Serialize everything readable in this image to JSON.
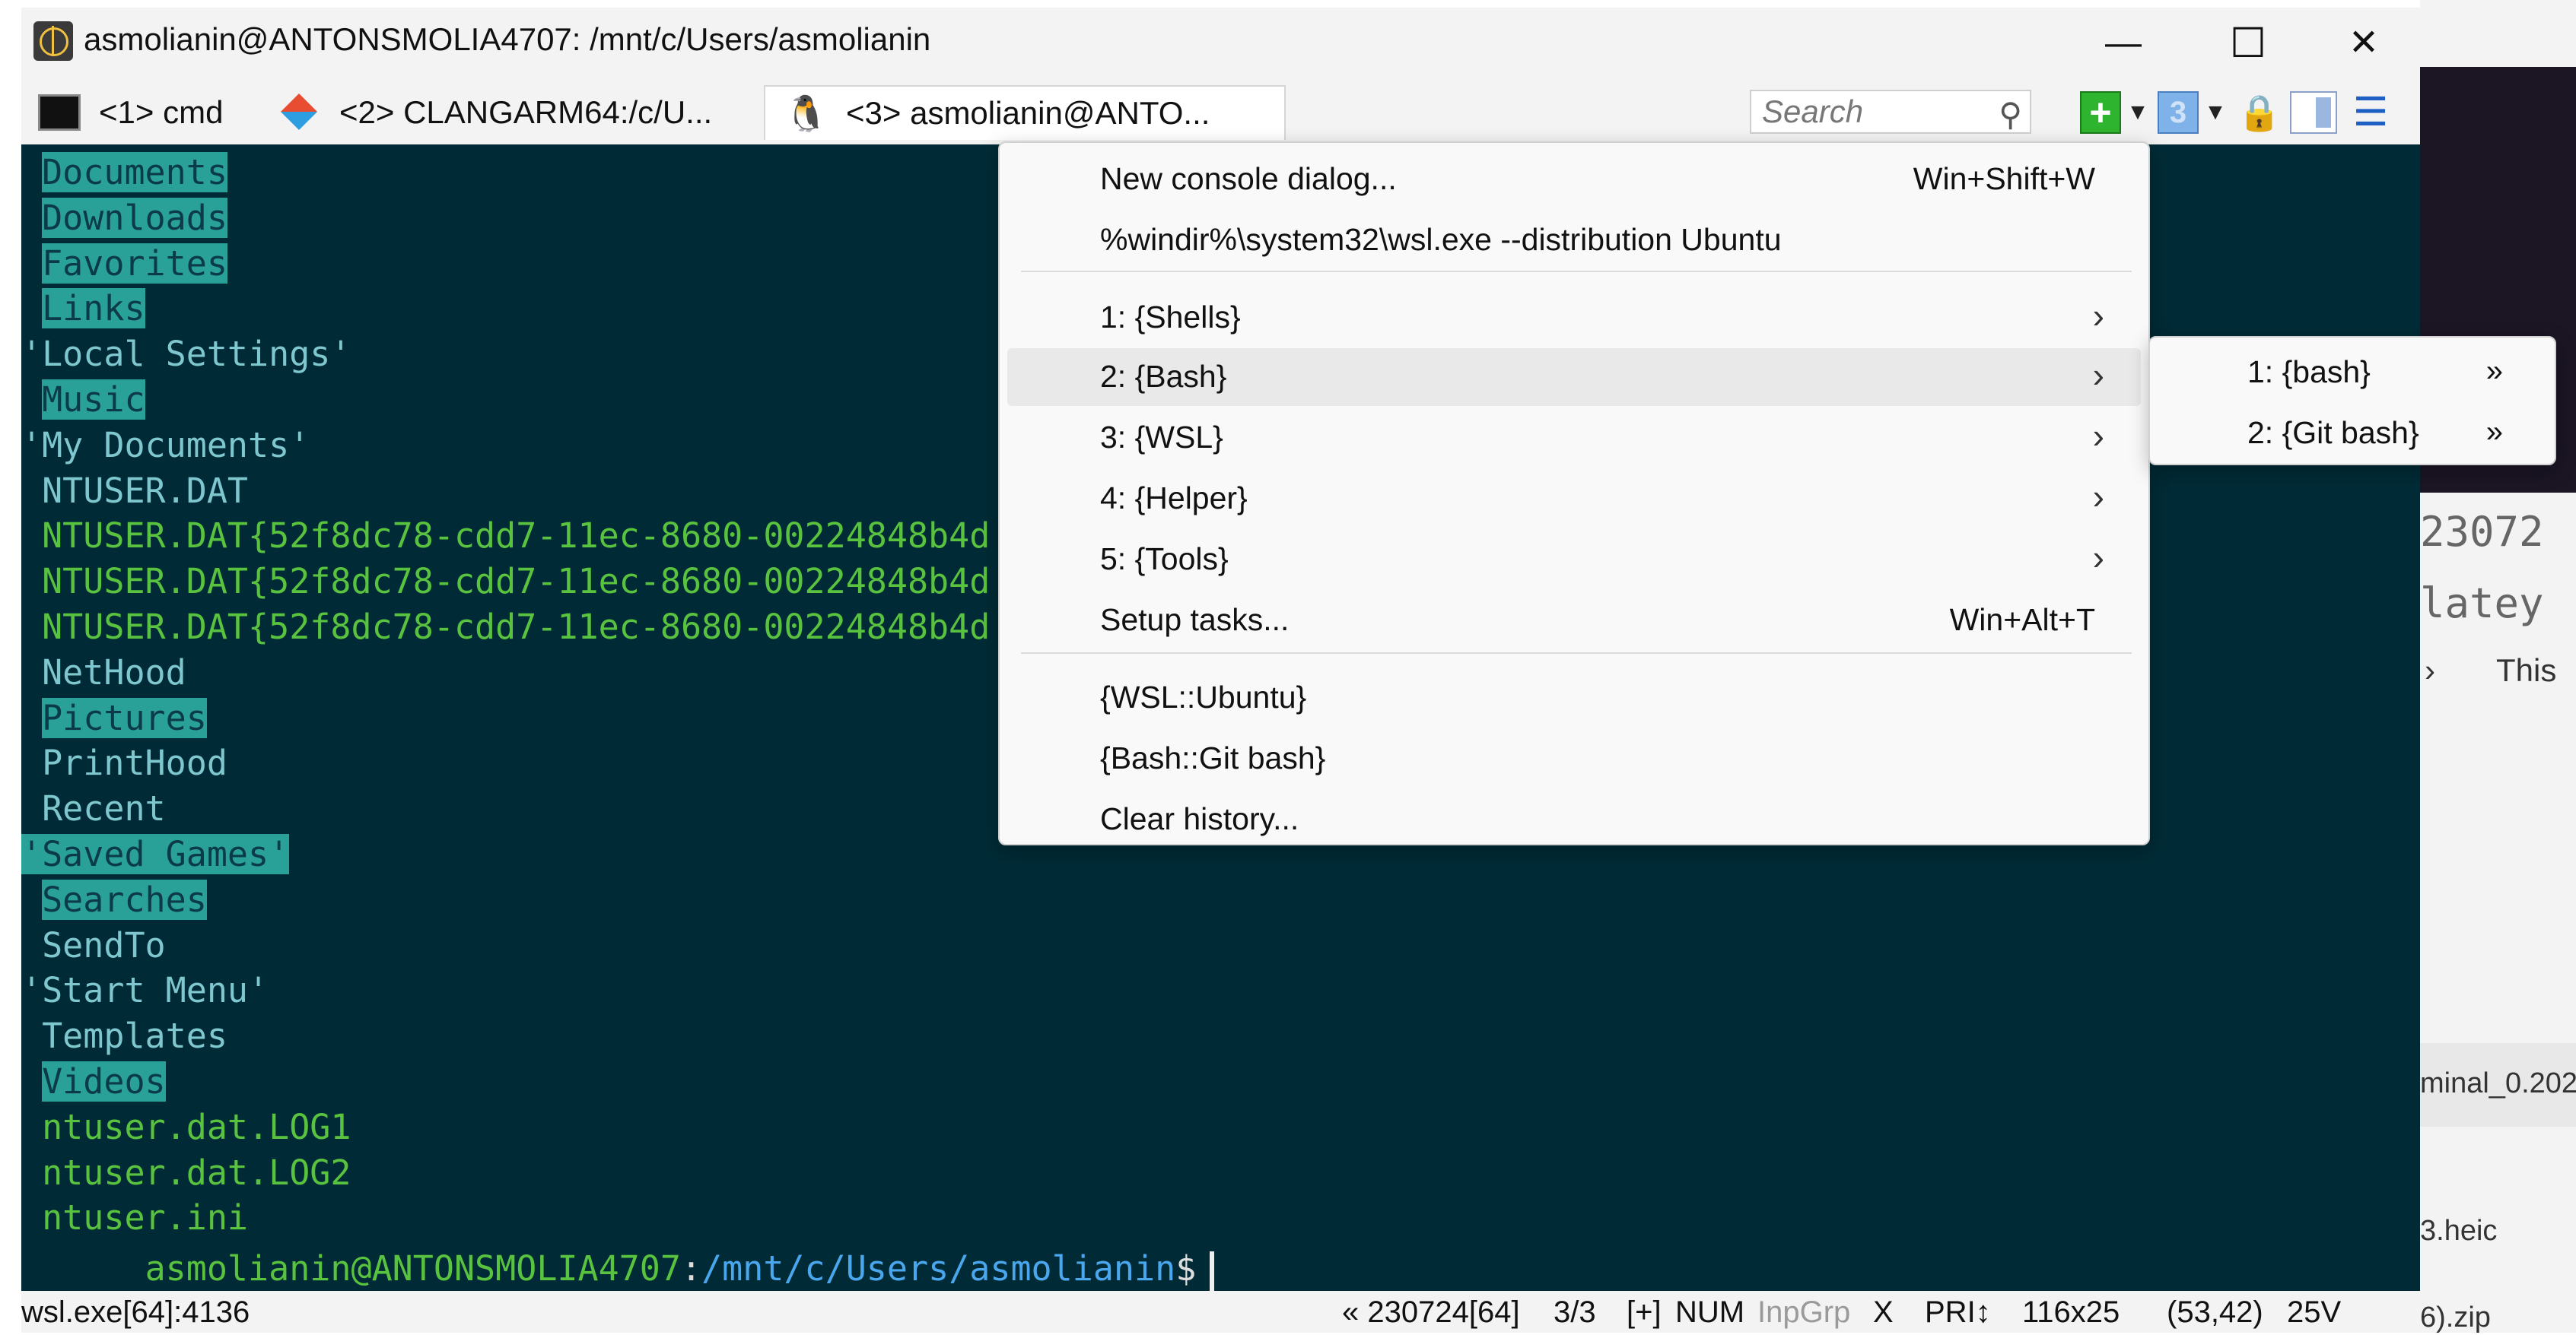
{
  "window": {
    "title": "asmolianin@ANTONSMOLIA4707: /mnt/c/Users/asmolianin",
    "minimize_glyph": "—",
    "maximize_glyph": "☐",
    "close_glyph": "✕"
  },
  "tabs": [
    {
      "label": "<1> cmd",
      "icon": "cmd-icon"
    },
    {
      "label": "<2> CLANGARM64:/c/U...",
      "icon": "git-icon"
    },
    {
      "label": "<3> asmolianin@ANTO...",
      "icon": "linux-penguin-icon",
      "active": true
    }
  ],
  "toolbar": {
    "search_placeholder": "Search",
    "new_console_glyph": "+",
    "tab_number": "3",
    "dropdown_glyph": "▼",
    "lock_glyph": "🔒",
    "menu_glyph": "☰"
  },
  "terminal": {
    "lines": [
      {
        "text": " Documents",
        "style": "hl"
      },
      {
        "text": " Downloads",
        "style": "hl"
      },
      {
        "text": " Favorites",
        "style": "hl"
      },
      {
        "text": " Links",
        "style": "hl"
      },
      {
        "text": "'Local Settings'",
        "style": "plain"
      },
      {
        "text": " Music",
        "style": "hl"
      },
      {
        "text": "'My Documents'",
        "style": "plain"
      },
      {
        "text": " NTUSER.DAT",
        "style": "plain"
      },
      {
        "text": " NTUSER.DAT{52f8dc78-cdd7-11ec-8680-00224848b4d",
        "style": "exe"
      },
      {
        "text": " NTUSER.DAT{52f8dc78-cdd7-11ec-8680-00224848b4d",
        "style": "exe"
      },
      {
        "text": " NTUSER.DAT{52f8dc78-cdd7-11ec-8680-00224848b4d",
        "style": "exe"
      },
      {
        "text": " NetHood",
        "style": "plain"
      },
      {
        "text": " Pictures",
        "style": "hl"
      },
      {
        "text": " PrintHood",
        "style": "plain"
      },
      {
        "text": " Recent",
        "style": "plain"
      },
      {
        "text": "'Saved Games'",
        "style": "hl"
      },
      {
        "text": " Searches",
        "style": "hl"
      },
      {
        "text": " SendTo",
        "style": "plain"
      },
      {
        "text": "'Start Menu'",
        "style": "plain"
      },
      {
        "text": " Templates",
        "style": "plain"
      },
      {
        "text": " Videos",
        "style": "hl"
      },
      {
        "text": " ntuser.dat.LOG1",
        "style": "exe"
      },
      {
        "text": " ntuser.dat.LOG2",
        "style": "exe"
      },
      {
        "text": " ntuser.ini",
        "style": "exe"
      }
    ],
    "prompt": {
      "user": "asmolianin@ANTONSMOLIA4707",
      "colon": ":",
      "path": "/mnt/c/Users/asmolianin",
      "sign": "$"
    }
  },
  "statusbar": {
    "process": "wsl.exe[64]:4136",
    "version": "« 230724[64]",
    "console_index": "3/3",
    "plus": "[+]",
    "num": "NUM",
    "inpgrp": "InpGrp",
    "x": "X",
    "pri": "PRI↕",
    "size": "116x25",
    "cursor_pos": "(53,42)",
    "transparency": "25V"
  },
  "menu": {
    "items": [
      {
        "label": "New console dialog...",
        "shortcut": "Win+Shift+W"
      },
      {
        "label": "%windir%\\system32\\wsl.exe --distribution Ubuntu",
        "shortcut": ""
      },
      {
        "label": "1: {Shells}",
        "submenu": true
      },
      {
        "label": "2: {Bash}",
        "submenu": true,
        "hover": true
      },
      {
        "label": "3: {WSL}",
        "submenu": true
      },
      {
        "label": "4: {Helper}",
        "submenu": true
      },
      {
        "label": "5: {Tools}",
        "submenu": true
      },
      {
        "label": "Setup tasks...",
        "shortcut": "Win+Alt+T"
      },
      {
        "label": "{WSL::Ubuntu}",
        "shortcut": ""
      },
      {
        "label": "{Bash::Git bash}",
        "shortcut": ""
      },
      {
        "label": "Clear history...",
        "shortcut": ""
      }
    ],
    "arrow_glyph": "›"
  },
  "submenu": {
    "items": [
      {
        "label": "1: {bash}",
        "arrow": "»"
      },
      {
        "label": "2: {Git bash}",
        "arrow": "»"
      }
    ]
  },
  "background": {
    "mono_line1": "23072",
    "mono_line2": "latey",
    "crumb_arrow": "›",
    "crumb_text": "This",
    "file1": "minal_0.202",
    "file2": "3.heic",
    "file3": "6).zip"
  }
}
